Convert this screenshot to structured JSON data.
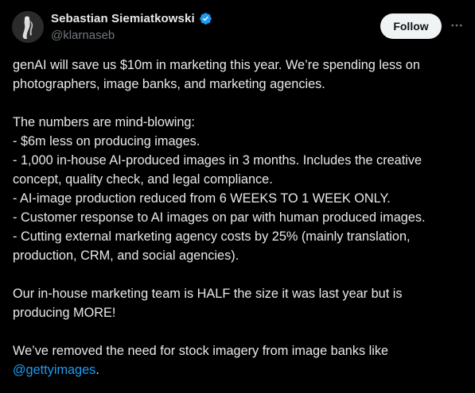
{
  "author": {
    "display_name": "Sebastian Siemiatkowski",
    "handle": "@klarnaseb",
    "verified": true,
    "avatar_icon": "profile-avatar"
  },
  "actions": {
    "follow_label": "Follow",
    "more_icon": "more-horizontal-icon"
  },
  "tweet": {
    "intro": [
      "genAI will save us $10m in marketing this year. We’re spending less on",
      "photographers, image banks, and marketing agencies."
    ],
    "numbers_heading": "The numbers are mind-blowing:",
    "bullets": [
      "- $6m less on producing images.",
      "- 1,000 in-house AI-produced images in 3 months. Includes the creative",
      "concept, quality check, and legal compliance.",
      "- AI-image production reduced from 6 WEEKS TO 1 WEEK ONLY.",
      "- Customer response to AI images on par with human produced images.",
      "- Cutting external marketing agency costs by 25% (mainly translation,",
      "production, CRM, and social agencies)."
    ],
    "team": [
      "Our in-house marketing team is HALF the size it was last year but is",
      "producing MORE!"
    ],
    "closing": {
      "line1": "We’ve removed the need for stock imagery from image banks like",
      "mention": "@gettyimages",
      "end": "."
    }
  },
  "colors": {
    "background": "#000000",
    "text": "#e7e9ea",
    "secondary": "#71767b",
    "link": "#1d9bf0",
    "verified": "#1d9bf0",
    "follow_bg": "#eff3f4"
  }
}
